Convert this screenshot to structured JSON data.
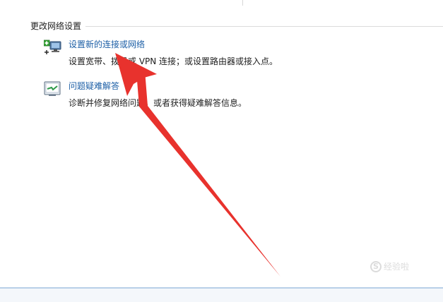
{
  "section": {
    "title": "更改网络设置"
  },
  "tasks": [
    {
      "link": "设置新的连接或网络",
      "description": "设置宽带、拨号或 VPN 连接；或设置路由器或接入点。",
      "icon": "network-setup-icon"
    },
    {
      "link": "问题疑难解答",
      "description": "诊断并修复网络问题，或者获得疑难解答信息。",
      "icon": "troubleshoot-icon"
    }
  ],
  "watermark": {
    "text": "经验啦"
  },
  "colors": {
    "link": "#1d5fa6",
    "arrow": "#e8322d",
    "rule": "#dcdcdc"
  }
}
